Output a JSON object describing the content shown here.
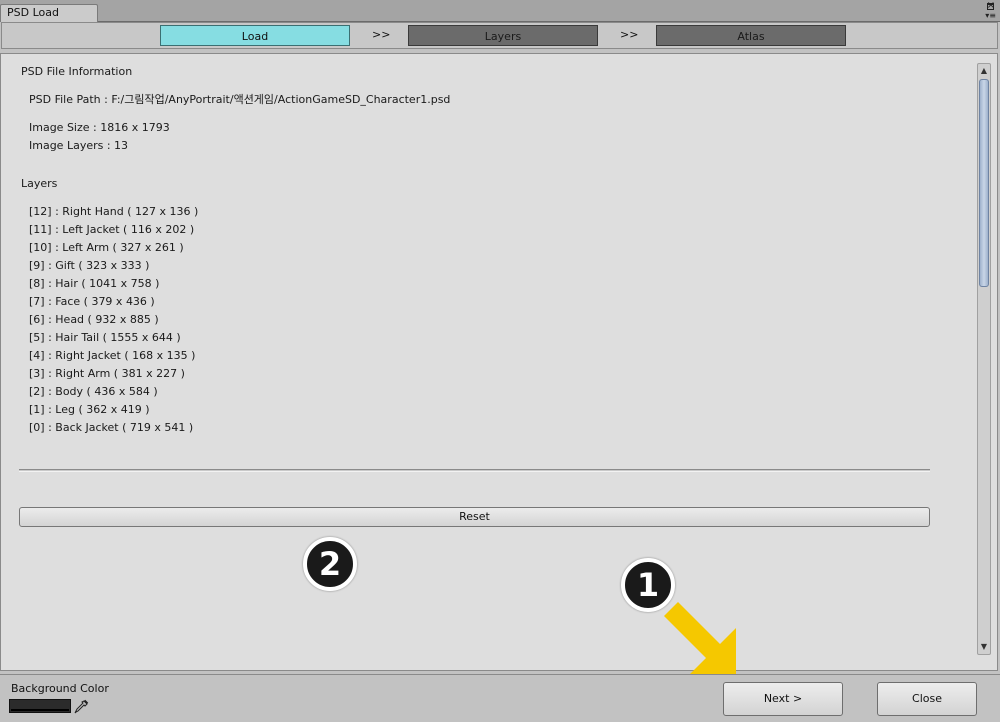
{
  "window": {
    "tab_title": "PSD Load",
    "close_glyph": "×",
    "menu_glyph": "▾≡"
  },
  "steps": [
    {
      "label": "Load",
      "active": true
    },
    {
      "label": "Layers",
      "active": false
    },
    {
      "label": "Atlas",
      "active": false
    }
  ],
  "step_separator": ">>",
  "info": {
    "section_title": "PSD File Information",
    "file_path": "PSD File Path : F:/그림작업/AnyPortrait/액션게임/ActionGameSD_Character1.psd",
    "image_size": "Image Size : 1816 x 1793",
    "image_layers": "Image Layers : 13"
  },
  "layers": {
    "section_title": "Layers",
    "items": [
      "[12] : Right Hand  ( 127 x 136 )",
      "[11] : Left Jacket  ( 116 x 202 )",
      "[10] : Left Arm  ( 327 x 261 )",
      "[9] : Gift  ( 323 x 333 )",
      "[8] : Hair  ( 1041 x 758 )",
      "[7] : Face  ( 379 x 436 )",
      "[6] : Head  ( 932 x 885 )",
      "[5] : Hair Tail  ( 1555 x 644 )",
      "[4] : Right Jacket  ( 168 x 135 )",
      "[3] : Right Arm  ( 381 x 227 )",
      "[2] : Body  ( 436 x 584 )",
      "[1] : Leg  ( 362 x 419 )",
      "[0] : Back Jacket  ( 719 x 541 )"
    ]
  },
  "reset_label": "Reset",
  "callouts": {
    "one": "1",
    "two": "2"
  },
  "bottom": {
    "bg_color_label": "Background Color",
    "bg_color_value": "#2b2b2b",
    "next_label": "Next >",
    "close_label": "Close"
  },
  "colors": {
    "active_step": "#86dde2",
    "inactive_step": "#6b6b6b",
    "arrow": "#f5c800"
  },
  "icons": {
    "eyedropper": "eyedropper-icon",
    "maximize": "maximize-icon",
    "close": "close-icon",
    "menu": "menu-icon",
    "arrow": "arrow-down-right-icon"
  }
}
